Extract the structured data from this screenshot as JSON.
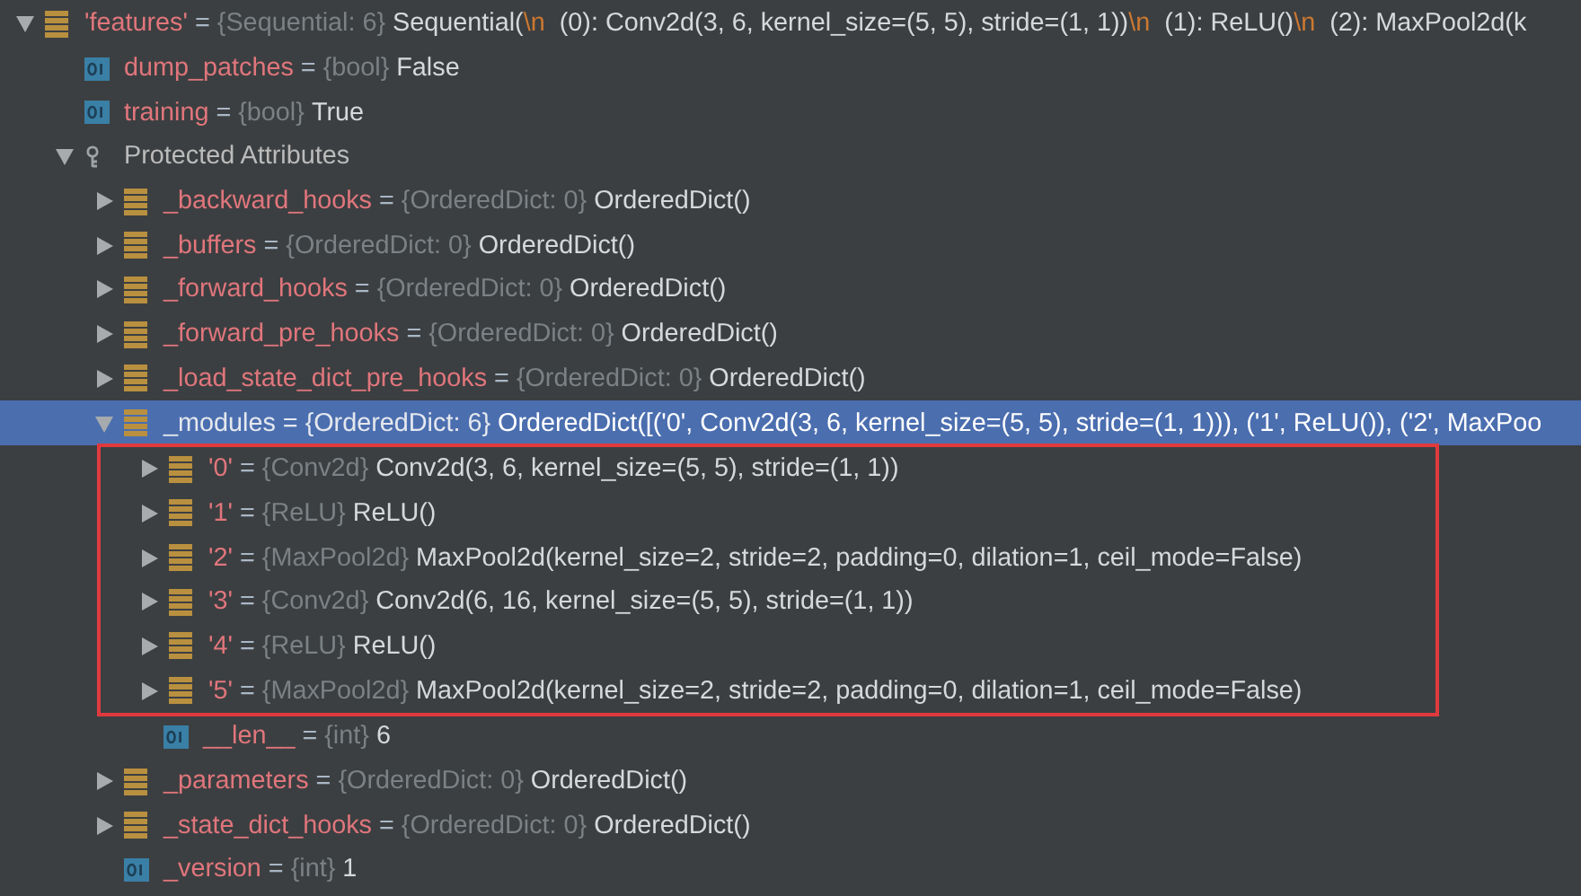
{
  "tree": [
    {
      "kind": "object",
      "name": "'features'",
      "equals": "=",
      "type": "{Sequential: 6}",
      "value_parts": [
        {
          "kind": "plain",
          "text": "Sequential("
        },
        {
          "kind": "escape",
          "text": "\\n"
        },
        {
          "kind": "plain",
          "text": "  (0): Conv2d(3, 6, kernel_size=(5, 5), stride=(1, 1))"
        },
        {
          "kind": "escape",
          "text": "\\n"
        },
        {
          "kind": "plain",
          "text": "  (1): ReLU()"
        },
        {
          "kind": "escape",
          "text": "\\n"
        },
        {
          "kind": "plain",
          "text": "  (2): MaxPool2d(k"
        }
      ],
      "expanded": true,
      "selected": false,
      "children": [
        {
          "kind": "primitive",
          "name": "dump_patches",
          "equals": "=",
          "type": "{bool}",
          "value_parts": [
            {
              "kind": "plain",
              "text": "False"
            }
          ],
          "selected": false
        },
        {
          "kind": "primitive",
          "name": "training",
          "equals": "=",
          "type": "{bool}",
          "value_parts": [
            {
              "kind": "plain",
              "text": "True"
            }
          ],
          "selected": false
        },
        {
          "kind": "group",
          "name": "Protected Attributes",
          "expanded": true,
          "selected": false,
          "children": [
            {
              "kind": "object",
              "name": "_backward_hooks",
              "equals": "=",
              "type": "{OrderedDict: 0}",
              "value_parts": [
                {
                  "kind": "plain",
                  "text": "OrderedDict()"
                }
              ],
              "expanded": false,
              "selected": false
            },
            {
              "kind": "object",
              "name": "_buffers",
              "equals": "=",
              "type": "{OrderedDict: 0}",
              "value_parts": [
                {
                  "kind": "plain",
                  "text": "OrderedDict()"
                }
              ],
              "expanded": false,
              "selected": false
            },
            {
              "kind": "object",
              "name": "_forward_hooks",
              "equals": "=",
              "type": "{OrderedDict: 0}",
              "value_parts": [
                {
                  "kind": "plain",
                  "text": "OrderedDict()"
                }
              ],
              "expanded": false,
              "selected": false
            },
            {
              "kind": "object",
              "name": "_forward_pre_hooks",
              "equals": "=",
              "type": "{OrderedDict: 0}",
              "value_parts": [
                {
                  "kind": "plain",
                  "text": "OrderedDict()"
                }
              ],
              "expanded": false,
              "selected": false
            },
            {
              "kind": "object",
              "name": "_load_state_dict_pre_hooks",
              "equals": "=",
              "type": "{OrderedDict: 0}",
              "value_parts": [
                {
                  "kind": "plain",
                  "text": "OrderedDict()"
                }
              ],
              "expanded": false,
              "selected": false
            },
            {
              "kind": "object",
              "name": "_modules",
              "equals": "=",
              "type": "{OrderedDict: 6}",
              "value_parts": [
                {
                  "kind": "plain",
                  "text": "OrderedDict([('0', Conv2d(3, 6, kernel_size=(5, 5), stride=(1, 1))), ('1', ReLU()), ('2', MaxPoo"
                }
              ],
              "expanded": true,
              "selected": true,
              "children": [
                {
                  "kind": "frame",
                  "children": [
                    {
                      "kind": "object",
                      "name": "'0'",
                      "equals": "=",
                      "type": "{Conv2d}",
                      "value_parts": [
                        {
                          "kind": "plain",
                          "text": "Conv2d(3, 6, kernel_size=(5, 5), stride=(1, 1))"
                        }
                      ],
                      "expanded": false,
                      "selected": false
                    },
                    {
                      "kind": "object",
                      "name": "'1'",
                      "equals": "=",
                      "type": "{ReLU}",
                      "value_parts": [
                        {
                          "kind": "plain",
                          "text": "ReLU()"
                        }
                      ],
                      "expanded": false,
                      "selected": false
                    },
                    {
                      "kind": "object",
                      "name": "'2'",
                      "equals": "=",
                      "type": "{MaxPool2d}",
                      "value_parts": [
                        {
                          "kind": "plain",
                          "text": "MaxPool2d(kernel_size=2, stride=2, padding=0, dilation=1, ceil_mode=False)"
                        }
                      ],
                      "expanded": false,
                      "selected": false
                    },
                    {
                      "kind": "object",
                      "name": "'3'",
                      "equals": "=",
                      "type": "{Conv2d}",
                      "value_parts": [
                        {
                          "kind": "plain",
                          "text": "Conv2d(6, 16, kernel_size=(5, 5), stride=(1, 1))"
                        }
                      ],
                      "expanded": false,
                      "selected": false
                    },
                    {
                      "kind": "object",
                      "name": "'4'",
                      "equals": "=",
                      "type": "{ReLU}",
                      "value_parts": [
                        {
                          "kind": "plain",
                          "text": "ReLU()"
                        }
                      ],
                      "expanded": false,
                      "selected": false
                    },
                    {
                      "kind": "object",
                      "name": "'5'",
                      "equals": "=",
                      "type": "{MaxPool2d}",
                      "value_parts": [
                        {
                          "kind": "plain",
                          "text": "MaxPool2d(kernel_size=2, stride=2, padding=0, dilation=1, ceil_mode=False)"
                        }
                      ],
                      "expanded": false,
                      "selected": false
                    }
                  ]
                },
                {
                  "kind": "primitive",
                  "name": "__len__",
                  "equals": "=",
                  "type": "{int}",
                  "value_parts": [
                    {
                      "kind": "plain",
                      "text": "6"
                    }
                  ],
                  "selected": false
                }
              ]
            },
            {
              "kind": "object",
              "name": "_parameters",
              "equals": "=",
              "type": "{OrderedDict: 0}",
              "value_parts": [
                {
                  "kind": "plain",
                  "text": "OrderedDict()"
                }
              ],
              "expanded": false,
              "selected": false
            },
            {
              "kind": "object",
              "name": "_state_dict_hooks",
              "equals": "=",
              "type": "{OrderedDict: 0}",
              "value_parts": [
                {
                  "kind": "plain",
                  "text": "OrderedDict()"
                }
              ],
              "expanded": false,
              "selected": false
            },
            {
              "kind": "primitive",
              "name": "_version",
              "equals": "=",
              "type": "{int}",
              "value_parts": [
                {
                  "kind": "plain",
                  "text": "1"
                }
              ],
              "selected": false
            }
          ]
        }
      ]
    }
  ]
}
